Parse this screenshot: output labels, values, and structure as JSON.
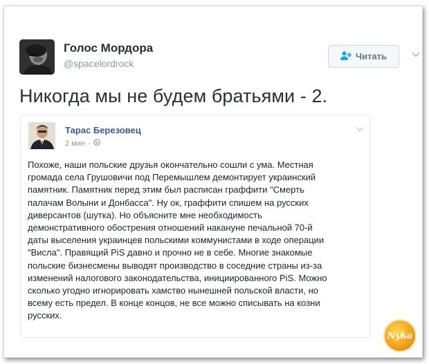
{
  "author": {
    "name": "Голос Мордора",
    "handle": "@spacelordrock"
  },
  "follow_button": {
    "icon": "add-user-icon",
    "label": "Читать"
  },
  "tweet": {
    "text": "Никогда мы не будем братьями - 2."
  },
  "quoted_post": {
    "author": "Тарас Березовец",
    "time": "2 мин",
    "separator": "·",
    "privacy_icon": "globe-icon",
    "lines": [
      "Похоже, наши польские друзья окончательно сошли с ума. Местная",
      "громада села Грушовичи под Перемышлем демонтирует украинский",
      "памятник. Памятник перед этим был расписан граффити \"Смерть",
      "палачам Волыни и Донбасса\". Ну ок, граффити спишем на русских",
      "диверсантов (шутка). Но объясните мне необходимость",
      "демонстративного обострения отношений накануне печальной 70-й",
      "даты выселения украинцев польскими коммунистами в ходе операции",
      "\"Висла\". Правящий PiS давно и прочно не в себе. Многие знакомые",
      "польские бизнесмены выводят производство в соседние страны из-за",
      "изменений налогового законодательства, инициированного PiS. Можно",
      "сколько угодно игнорировать хамство нынешней польской власти, но",
      "всему есть предел. В конце концов, не все можно списывать на козни",
      "русских."
    ]
  },
  "watermark": {
    "text": "Nyka"
  },
  "colors": {
    "name": "#292f33",
    "handle": "#8899a6",
    "quote_author": "#3b5998",
    "accent": "#1da1f2"
  }
}
